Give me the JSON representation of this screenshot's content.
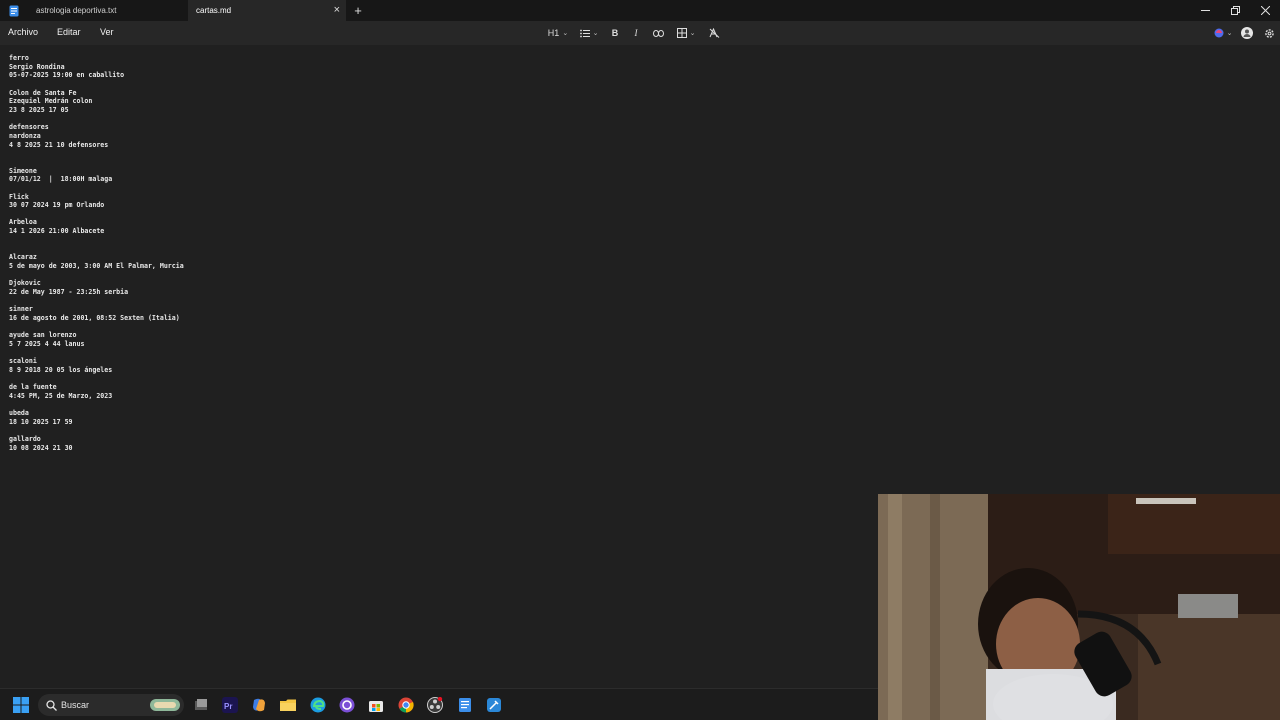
{
  "tabs": [
    {
      "label": "astrologia deportiva.txt",
      "active": false
    },
    {
      "label": "cartas.md",
      "active": true
    }
  ],
  "new_tab_label": "+",
  "menu": [
    "Archivo",
    "Editar",
    "Ver"
  ],
  "toolbar": {
    "heading": "H1"
  },
  "lines": [
    "ferro",
    "Sergio Rondina",
    "05-07-2025 19:00 en caballito",
    "",
    "Colon de Santa Fe",
    "Ezequiel Medrán colon",
    "23 8 2025 17 05",
    "",
    "defensores",
    "nardonza",
    "4 8 2025 21 10 defensores",
    "",
    "",
    "Simeone",
    "07/01/12  |  18:00H malaga",
    "",
    "Flick",
    "30 07 2024 19 pm Orlando",
    "",
    "Arbeloa",
    "14 1 2026 21:00 Albacete",
    "",
    "",
    "Alcaraz",
    "5 de mayo de 2003, 3:00 AM El Palmar, Murcia",
    "",
    "Djokovic",
    "22 de May 1987 - 23:25h serbia",
    "",
    "sinner",
    "16 de agosto de 2001, 08:52 Sexten (Italia)",
    "",
    "ayude san lorenzo",
    "5 7 2025 4 44 lanus",
    "",
    "scaloni",
    "8 9 2018 20 05 los ángeles",
    "",
    "de la fuente",
    "4:45 PM, 25 de Marzo, 2023",
    "",
    "ubeda",
    "18 10 2025 17 59",
    "",
    "gallardo",
    "10 08 2024 21 30"
  ],
  "taskbar": {
    "search_label": "Buscar"
  },
  "colors": {
    "background": "#202020",
    "tab_bar": "#171717",
    "menu_bar": "#272727",
    "accent": "#0078d4",
    "spellcheck": "#e53935"
  }
}
